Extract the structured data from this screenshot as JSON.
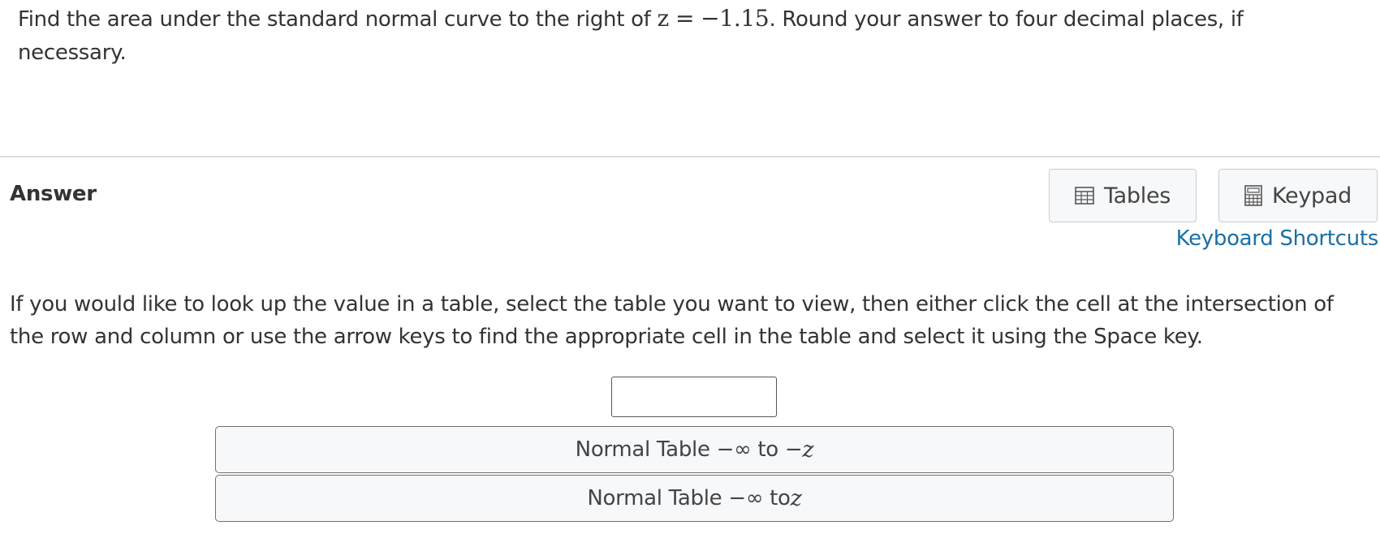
{
  "question": {
    "text_before": "Find the area under the standard normal curve to the right of ",
    "math_var": "z",
    "math_op": "=",
    "math_value": "−1.15",
    "text_after": ".  Round your answer to four decimal places, if necessary."
  },
  "answer": {
    "label": "Answer",
    "input_value": ""
  },
  "toolbar": {
    "tables_label": "Tables",
    "keypad_label": "Keypad",
    "shortcuts_label": "Keyboard Shortcuts"
  },
  "instructions": "If you would like to look up the value in a table, select the table you want to view, then either click the cell at the intersection of the row and column or use the arrow keys to find the appropriate cell in the table and select it using the Space key.",
  "tables": [
    {
      "prefix": "Normal Table −∞ to −",
      "var": "z"
    },
    {
      "prefix": "Normal Table −∞ to ",
      "var": "z"
    }
  ],
  "icons": {
    "tables": "table-grid-icon",
    "keypad": "calculator-icon"
  },
  "colors": {
    "link": "#1a6fa8",
    "text": "#333333",
    "button_bg": "#f7f8fa"
  }
}
